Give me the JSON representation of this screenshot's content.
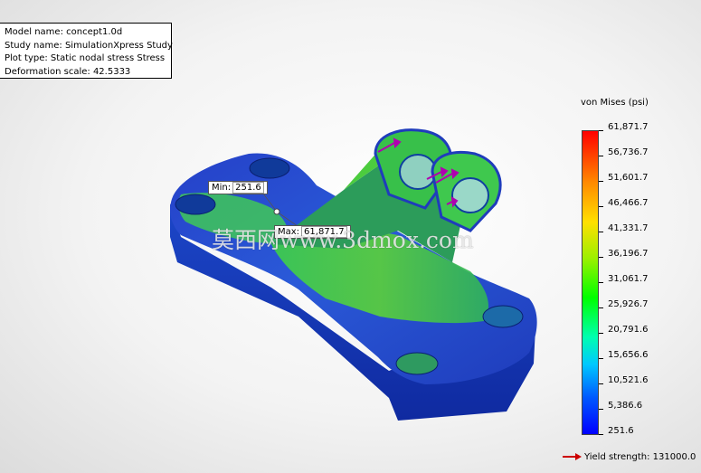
{
  "info": {
    "model_name": "Model name: concept1.0d",
    "study_name": "Study name: SimulationXpress Study",
    "plot_type": "Plot type: Static nodal stress Stress",
    "deformation_scale": "Deformation scale: 42.5333"
  },
  "callouts": {
    "min_label": "Min:",
    "min_value": "251.6",
    "max_label": "Max:",
    "max_value": "61,871.7"
  },
  "watermark": "莫西网www.3dmox.com",
  "legend": {
    "title": "von Mises (psi)",
    "ticks": [
      "61,871.7",
      "56,736.7",
      "51,601.7",
      "46,466.7",
      "41,331.7",
      "36,196.7",
      "31,061.7",
      "25,926.7",
      "20,791.6",
      "15,656.6",
      "10,521.6",
      "5,386.6",
      "251.6"
    ],
    "yield_label": "Yield strength: 131000.0"
  },
  "colors": {
    "body_blue": "#1d3fbf",
    "stress_green": "#33c23a",
    "load_arrow": "#b000b0",
    "yield_arrow": "#cc0000"
  }
}
